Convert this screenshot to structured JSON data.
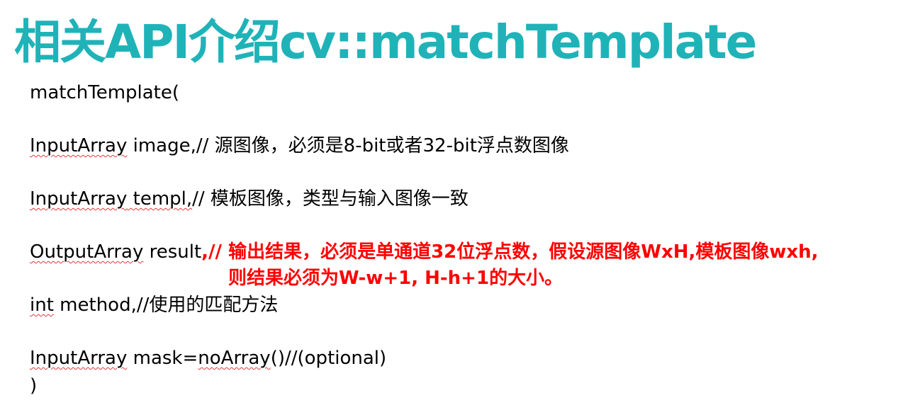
{
  "title": {
    "text": "相关API介绍cv::matchTemplate",
    "color": "#1fb3b8"
  },
  "colors": {
    "text": "#000000",
    "emphasis": "#ff0000",
    "spell_underline": "#e03a3a"
  },
  "signature": {
    "open": "matchTemplate(",
    "params": [
      {
        "type": "InputArray",
        "name": " image,",
        "comment": "// 源图像，必须是8-bit或者32-bit浮点数图像"
      },
      {
        "type": "InputArray",
        "name": " templ,",
        "comment": "// 模板图像，类型与输入图像一致"
      },
      {
        "type": "OutputArray",
        "name": " result",
        "comment": ",// 输出结果，必须是单通道32位浮点数，假设源图像WxH,模板图像wxh,",
        "comment_cont": "则结果必须为W-w+1, H-h+1的大小。"
      },
      {
        "type": "int",
        "name": " method,",
        "comment": "//使用的匹配方法"
      },
      {
        "type": "InputArray",
        "name": " mask=",
        "default": "noArray",
        "comment": "()//(optional)"
      }
    ],
    "close": ")"
  }
}
